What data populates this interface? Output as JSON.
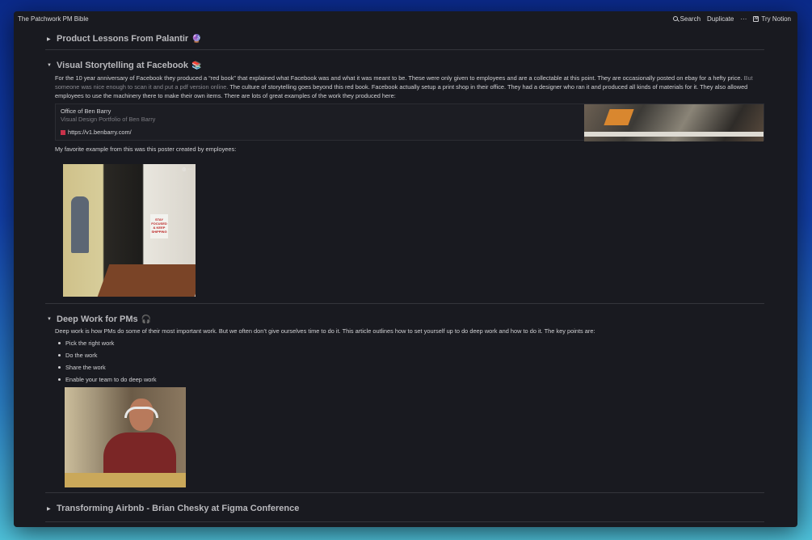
{
  "topbar": {
    "title": "The Patchwork PM Bible",
    "search": "Search",
    "duplicate": "Duplicate",
    "more": "···",
    "try_notion": "Try Notion"
  },
  "sections": [
    {
      "title": "Product Lessons From Palantir",
      "emoji": "🔮",
      "toggle": "▶"
    },
    {
      "title": "Visual Storytelling at Facebook",
      "emoji": "📚",
      "toggle": "▼",
      "para_a": "For the 10 year anniversary of Facebook they produced a “red book” that explained what Facebook was and what it was meant to be. These were only given to employees and are a collectable at this point. They are occasionally posted on ebay for a hefty price.",
      "para_link": "But someone was nice enough to scan it and put a pdf version online.",
      "para_b": "The culture of storytelling goes beyond this red book. Facebook actually setup a print shop in their office. They had a designer who ran it and produced all kinds of materials for it. They also allowed employees to use the machinery there to make their own items. There are lots of great examples of the work they produced here:",
      "bookmark": {
        "title": "Office of Ben Barry",
        "description": "Visual Design Portfolio of Ben Barry",
        "url": "https://v1.benbarry.com/"
      },
      "note": "My favorite example from this was this poster created by employees:",
      "poster_text": "STAY FOCUSED & KEEP SHIPPING"
    },
    {
      "title": "Deep Work for PMs",
      "emoji": "🎧",
      "toggle": "▼",
      "para": "Deep work is how PMs do some of their most important work. But we often don’t give ourselves time to do it. This article outlines how to set yourself up to do deep work and how to do it. The key points are:",
      "bullets": [
        "Pick the right work",
        "Do the work",
        "Share the work",
        "Enable your team to do deep work"
      ]
    },
    {
      "title": "Transforming Airbnb - Brian Chesky at Figma Conference",
      "toggle": "▶"
    }
  ]
}
